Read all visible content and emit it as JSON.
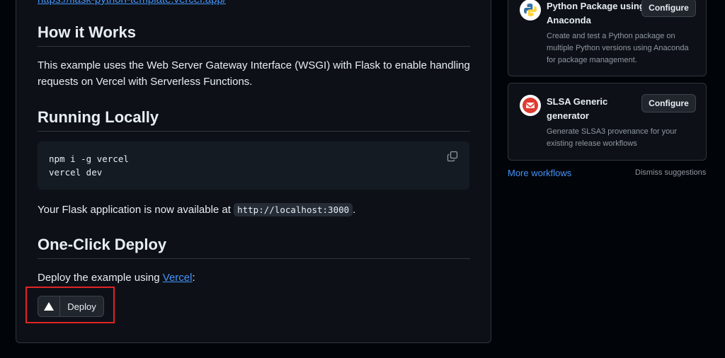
{
  "readme": {
    "top_link": "https://flask-python-template.vercel.app/",
    "how_it_works": {
      "heading": "How it Works",
      "text": "This example uses the Web Server Gateway Interface (WSGI) with Flask to enable handling requests on Vercel with Serverless Functions."
    },
    "running_locally": {
      "heading": "Running Locally",
      "code_lines": [
        "npm i -g vercel",
        "vercel dev"
      ],
      "after_text_before": "Your Flask application is now available at",
      "after_code": "http://localhost:3000",
      "after_text_end": "."
    },
    "one_click": {
      "heading": "One-Click Deploy",
      "text_before": "Deploy the example using",
      "link": "Vercel",
      "text_after": ":",
      "deploy_label": "Deploy"
    }
  },
  "sidebar": {
    "cards": [
      {
        "title": "Python Package using Anaconda",
        "description": "Create and test a Python package on multiple Python versions using Anaconda for package management.",
        "button": "Configure",
        "icon": "python-icon"
      },
      {
        "title": "SLSA Generic generator",
        "description": "Generate SLSA3 provenance for your existing release workflows",
        "button": "Configure",
        "icon": "slsa-icon"
      }
    ],
    "more_workflows": "More workflows",
    "dismiss": "Dismiss suggestions"
  },
  "colors": {
    "background": "#0d1117",
    "link": "#4493f8",
    "highlight": "#e02424"
  }
}
